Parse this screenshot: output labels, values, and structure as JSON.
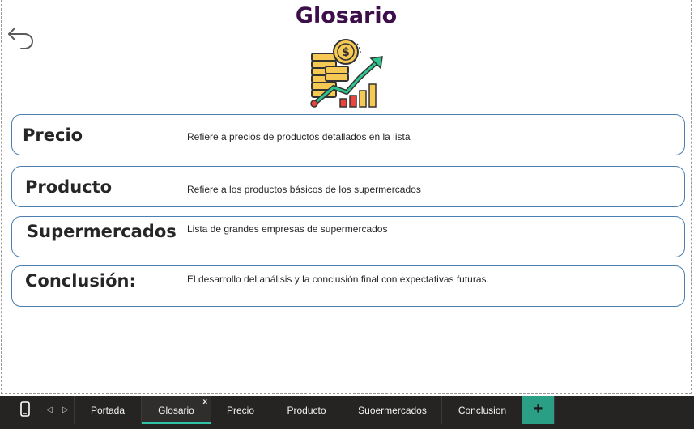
{
  "page": {
    "title": "Glosario",
    "back_icon": "back-arrow-icon",
    "hero_icon": "money-growth-chart-icon"
  },
  "glossary": [
    {
      "term": "Precio",
      "description": "Refiere a precios de productos detallados en la lista"
    },
    {
      "term": "Producto",
      "description": "Refiere a los productos básicos de los supermercados"
    },
    {
      "term": "Supermercados",
      "description": "Lista de grandes empresas de supermercados"
    },
    {
      "term": "Conclusión:",
      "description": "El desarrollo del análisis y la conclusión final con expectativas futuras."
    }
  ],
  "tabbar": {
    "device_icon": "mobile-layout-icon",
    "prev_icon": "chevron-left-icon",
    "next_icon": "chevron-right-icon",
    "tabs": [
      {
        "label": "Portada",
        "active": false
      },
      {
        "label": "Glosario",
        "active": true
      },
      {
        "label": "Precio",
        "active": false
      },
      {
        "label": "Producto",
        "active": false
      },
      {
        "label": "Suoermercados",
        "active": false
      },
      {
        "label": "Conclusion",
        "active": false
      }
    ],
    "close_label": "x",
    "add_label": "+"
  },
  "colors": {
    "title": "#3d0f4a",
    "card_border": "#4a7fb0",
    "tabbar_bg": "#252423",
    "accent": "#2ec4a5",
    "add_button": "#2b9f85"
  }
}
